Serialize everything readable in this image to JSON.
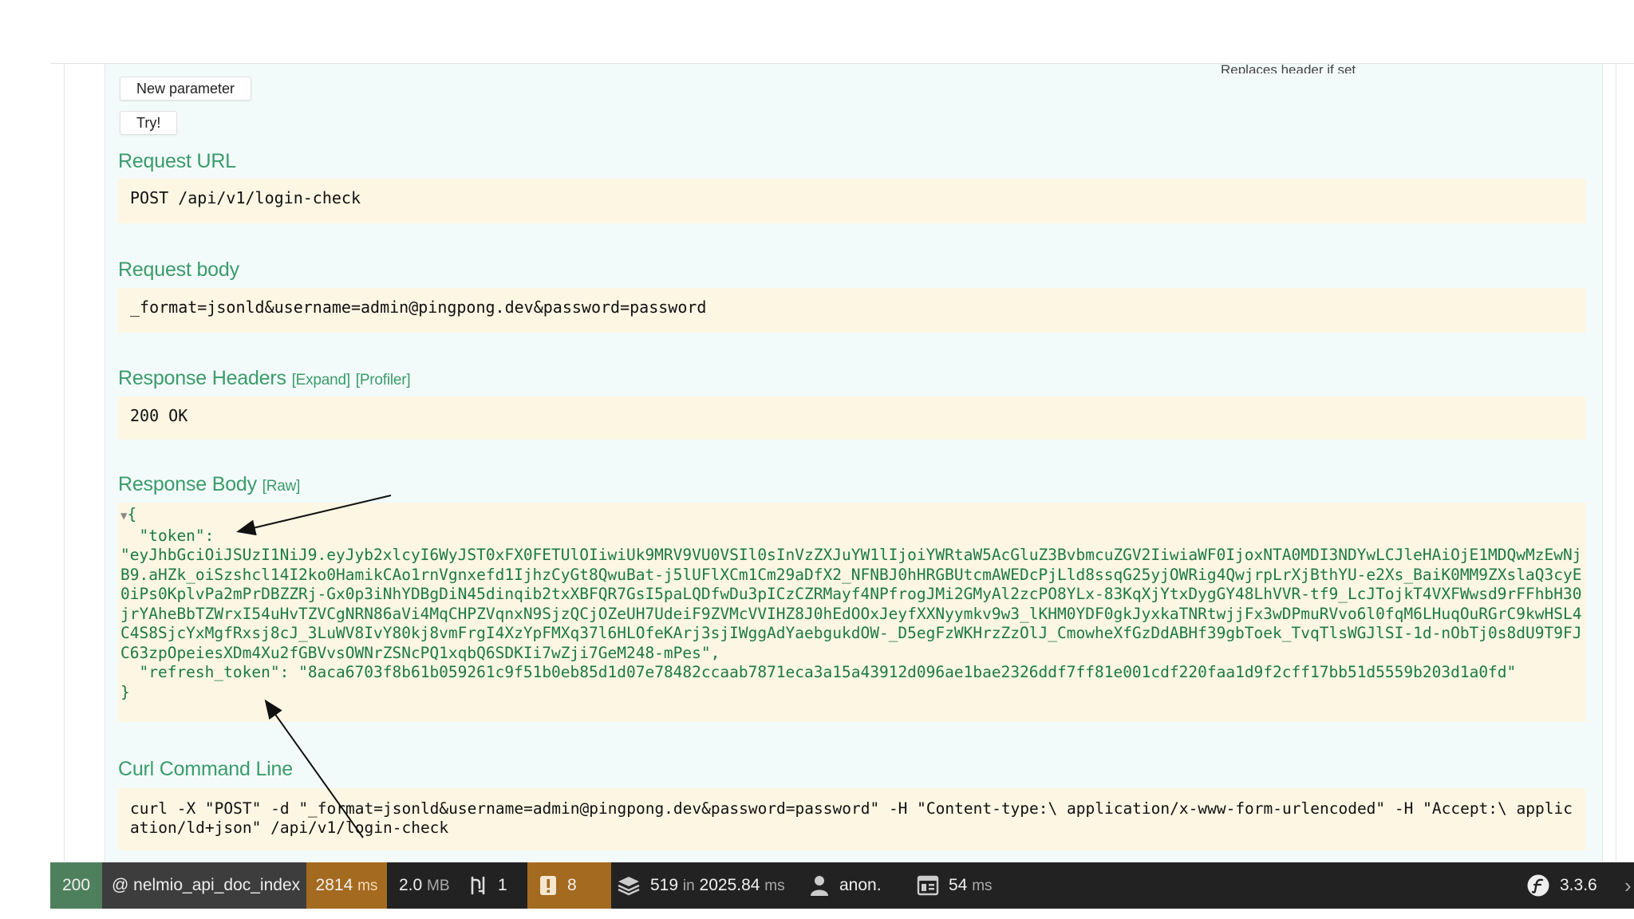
{
  "form": {
    "hint": "Replaces header if set",
    "new_parameter_label": "New parameter",
    "try_label": "Try!"
  },
  "request_url": {
    "title": "Request URL",
    "value": "POST /api/v1/login-check"
  },
  "request_body": {
    "title": "Request body",
    "value": "_format=jsonld&username=admin@pingpong.dev&password=password"
  },
  "response_headers": {
    "title": "Response Headers",
    "expand_label": "[Expand]",
    "profiler_label": "[Profiler]",
    "value": "200 OK"
  },
  "response_body": {
    "title": "Response Body",
    "raw_label": "[Raw]",
    "open_brace": "{",
    "close_brace": "}",
    "token_key": "\"token\":",
    "token_value": "\"eyJhbGciOiJSUzI1NiJ9.eyJyb2xlcyI6WyJST0xFX0FETUlOIiwiUk9MRV9VU0VSIl0sInVzZXJuYW1lIjoiYWRtaW5AcGluZ3BvbmcuZGV2IiwiaWF0IjoxNTA0MDI3NDYwLCJleHAiOjE1MDQwMzEwNjB9.aHZk_oiSzshcl14I2ko0HamikCAo1rnVgnxefd1IjhzCyGt8QwuBat-j5lUFlXCm1Cm29aDfX2_NFNBJ0hHRGBUtcmAWEDcPjLld8ssqG25yjOWRig4QwjrpLrXjBthYU-e2Xs_BaiK0MM9ZXslaQ3cyE0iPs0KplvPa2mPrDBZZRj-Gx0p3iNhYDBgDiN45dinqib2txXBFQR7GsI5paLQDfwDu3pICzCZRMayf4NPfrogJMi2GMyAl2zcPO8YLx-83KqXjYtxDygGY48LhVVR-tf9_LcJTojkT4VXFWwsd9rFFhbH30jrYAheBbTZWrxI54uHvTZVCgNRN86aVi4MqCHPZVqnxN9SjzQCjOZeUH7UdeiF9ZVMcVVIHZ8J0hEdOOxJeyfXXNyymkv9w3_lKHM0YDF0gkJyxkaTNRtwjjFx3wDPmuRVvo6l0fqM6LHuqOuRGrC9kwHSL4C4S8SjcYxMgfRxsj8cJ_3LuWV8IvY80kj8vmFrgI4XzYpFMXq37l6HLOfeKArj3sjIWggAdYaebgukdOW-_D5egFzWKHrzZzOlJ_CmowheXfGzDdABHf39gbToek_TvqTlsWGJlSI-1d-nObTj0s8dU9T9FJC63zpOpeiesXDm4Xu2fGBVvsOWNrZSNcPQ1xqbQ6SDKIi7wZji7GeM248-mPes\",",
    "refresh_key": "\"refresh_token\":",
    "refresh_value": "\"8aca6703f8b61b059261c9f51b0eb85d1d07e78482ccaab7871eca3a15a43912d096ae1bae2326ddf7ff81e001cdf220faa1d9f2cff17bb51d5559b203d1a0fd\""
  },
  "curl": {
    "title": "Curl Command Line",
    "value": "curl -X \"POST\" -d \"_format=jsonld&username=admin@pingpong.dev&password=password\" -H \"Content-type:\\ application/x-www-form-urlencoded\" -H \"Accept:\\ application/ld+json\" /api/v1/login-check"
  },
  "toolbar": {
    "status": "200",
    "route": "@ nelmio_api_doc_index",
    "time": "2814",
    "time_unit": "ms",
    "memory": "2.0",
    "memory_unit": "MB",
    "forms_count": "1",
    "logs_count": "8",
    "db_queries": "519",
    "db_in": "in",
    "db_time": "2025.84",
    "db_unit": "ms",
    "user": "anon.",
    "twig_time": "54",
    "twig_unit": "ms",
    "symfony_version": "3.3.6",
    "colors": {
      "status_ok": "#4f805d",
      "warning": "#a46a1f",
      "bar": "#222222"
    }
  }
}
